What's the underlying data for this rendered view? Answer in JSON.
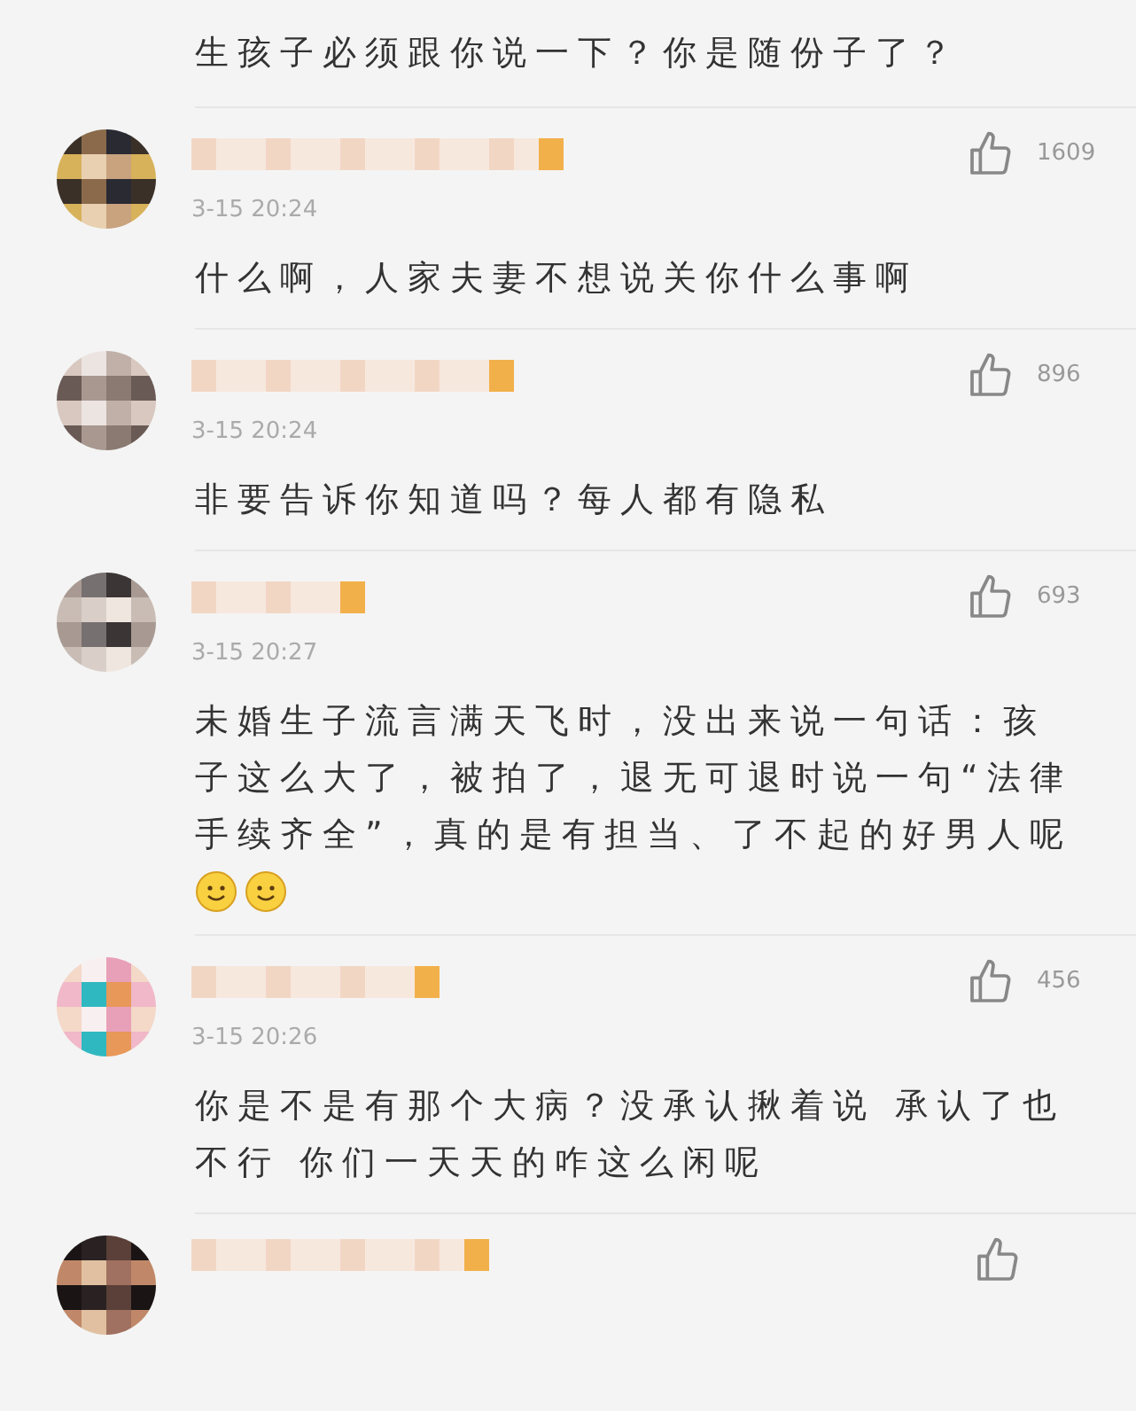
{
  "top_comment_tail": {
    "text": "生孩子必须跟你说一下？你是随份子了？"
  },
  "comments": [
    {
      "kind": "full",
      "time": "3-15 20:24",
      "likes": "1609",
      "text": "什么啊，人家夫妻不想说关你什么事啊"
    },
    {
      "kind": "full",
      "time": "3-15 20:24",
      "likes": "896",
      "text": "非要告诉你知道吗？每人都有隐私"
    },
    {
      "kind": "full",
      "time": "3-15 20:27",
      "likes": "693",
      "text": "未婚生子流言满天飞时，没出来说一句话：孩子这么大了，被拍了，退无可退时说一句“法律手续齐全”，真的是有担当、了不起的好男人呢",
      "emojis": [
        {
          "kind": "smile"
        },
        {
          "kind": "smile"
        }
      ]
    },
    {
      "kind": "full",
      "time": "3-15 20:26",
      "likes": "456",
      "text": "你是不是有那个大病？没承认揪着说 承认了也不行 你们一天天的咋这么闲呢"
    },
    {
      "kind": "cut"
    }
  ]
}
